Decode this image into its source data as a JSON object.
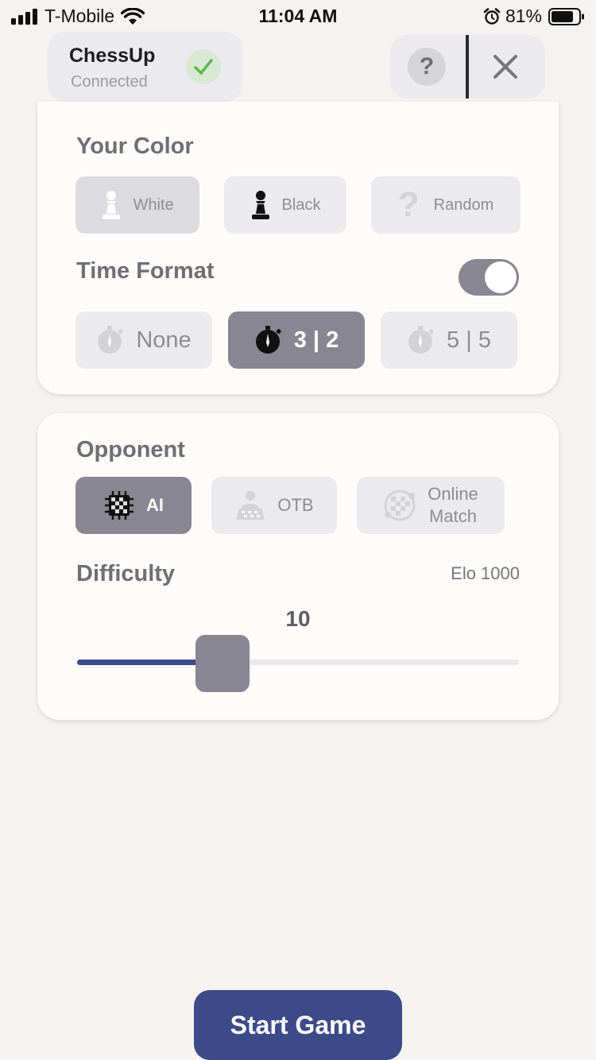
{
  "status_bar": {
    "carrier": "T-Mobile",
    "time": "11:04 AM",
    "battery_percent": "81%",
    "icons": [
      "signal-icon",
      "wifi-icon",
      "alarm-icon",
      "battery-icon"
    ]
  },
  "header": {
    "device_name": "ChessUp",
    "device_status": "Connected",
    "help_label": "?"
  },
  "color_section": {
    "title": "Your Color",
    "options": [
      {
        "label": "White",
        "icon": "white-pawn-icon",
        "selected": true
      },
      {
        "label": "Black",
        "icon": "black-pawn-icon",
        "selected": false
      },
      {
        "label": "Random",
        "icon": "question-mark-icon",
        "selected": false
      }
    ]
  },
  "time_section": {
    "title": "Time Format",
    "toggle_on": true,
    "options": [
      {
        "label": "None",
        "icon": "stopwatch-icon",
        "selected": false
      },
      {
        "label": "3 | 2",
        "icon": "stopwatch-icon",
        "selected": true
      },
      {
        "label": "5 | 5",
        "icon": "stopwatch-icon",
        "selected": false
      }
    ]
  },
  "opponent_section": {
    "title": "Opponent",
    "options": [
      {
        "label": "AI",
        "icon": "chip-icon",
        "selected": true
      },
      {
        "label": "OTB",
        "icon": "player-board-icon",
        "selected": false
      },
      {
        "label": "Online Match",
        "line1": "Online",
        "line2": "Match",
        "icon": "globe-board-icon",
        "selected": false
      }
    ]
  },
  "difficulty": {
    "title": "Difficulty",
    "elo": "Elo 1000",
    "value": "10",
    "level_fraction": 0.33
  },
  "start_button": "Start Game",
  "colors": {
    "accent": "#3c4a87",
    "selected": "#878691",
    "option_bg": "#ebeaec",
    "connected_check": "#5cb84e"
  }
}
